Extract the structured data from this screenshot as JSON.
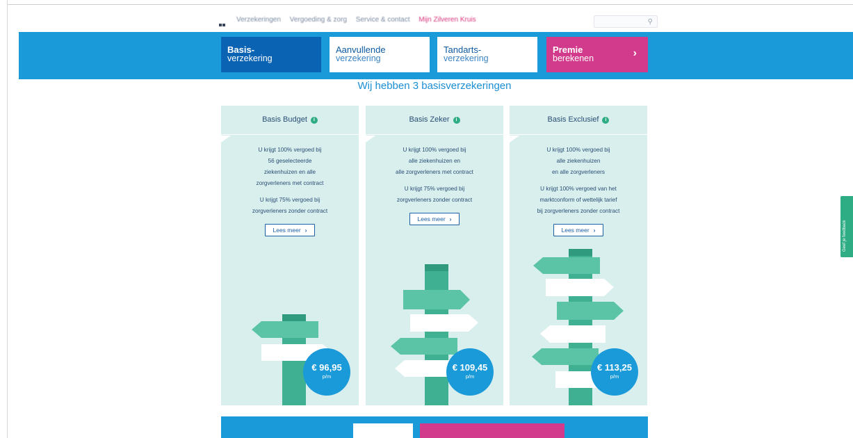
{
  "nav": {
    "links": [
      "Verzekeringen",
      "Vergoeding & zorg",
      "Service & contact",
      "Mijn Zilveren Kruis"
    ],
    "search_icon": "search-icon"
  },
  "tabs": [
    {
      "line1": "Basis-",
      "line2": "verzekering"
    },
    {
      "line1": "Aanvullende",
      "line2": "verzekering"
    },
    {
      "line1": "Tandarts-",
      "line2": "verzekering"
    },
    {
      "line1": "Premie",
      "line2": "berekenen",
      "chevron": "›"
    }
  ],
  "heading": "Wij hebben 3 basisverzekeringen",
  "cards": [
    {
      "title": "Basis Budget",
      "p1": [
        "U krijgt 100% vergoed bij",
        "56 geselecteerde",
        "ziekenhuizen en alle",
        "zorgverleners met contract"
      ],
      "p2": [
        "U krijgt 75% vergoed bij",
        "zorgverleners zonder contract"
      ],
      "button": "Lees meer",
      "price": "€ 96,95",
      "unit": "p/m"
    },
    {
      "title": "Basis Zeker",
      "p1": [
        "U krijgt 100% vergoed bij",
        "alle ziekenhuizen en",
        "alle zorgverleners met contract"
      ],
      "p2": [
        "U krijgt 75% vergoed bij",
        "zorgverleners zonder contract"
      ],
      "button": "Lees meer",
      "price": "€ 109,45",
      "unit": "p/m"
    },
    {
      "title": "Basis Exclusief",
      "p1": [
        "U krijgt 100% vergoed bij",
        "alle ziekenhuizen",
        "en alle zorgverleners"
      ],
      "p2": [
        "U krijgt 100% vergoed van het",
        "marktconform of wettelijk tarief",
        "bij zorgverleners zonder contract"
      ],
      "button": "Lees meer",
      "price": "€ 113,25",
      "unit": "p/m"
    }
  ],
  "feedback": "Geef je feedback",
  "colors": {
    "band": "#1a9ad9",
    "active_tab": "#0b63b4",
    "premie": "#d23a8b",
    "card_bg": "#d8efee",
    "sign_green": "#5cc4a6",
    "post": "#3fb092"
  }
}
